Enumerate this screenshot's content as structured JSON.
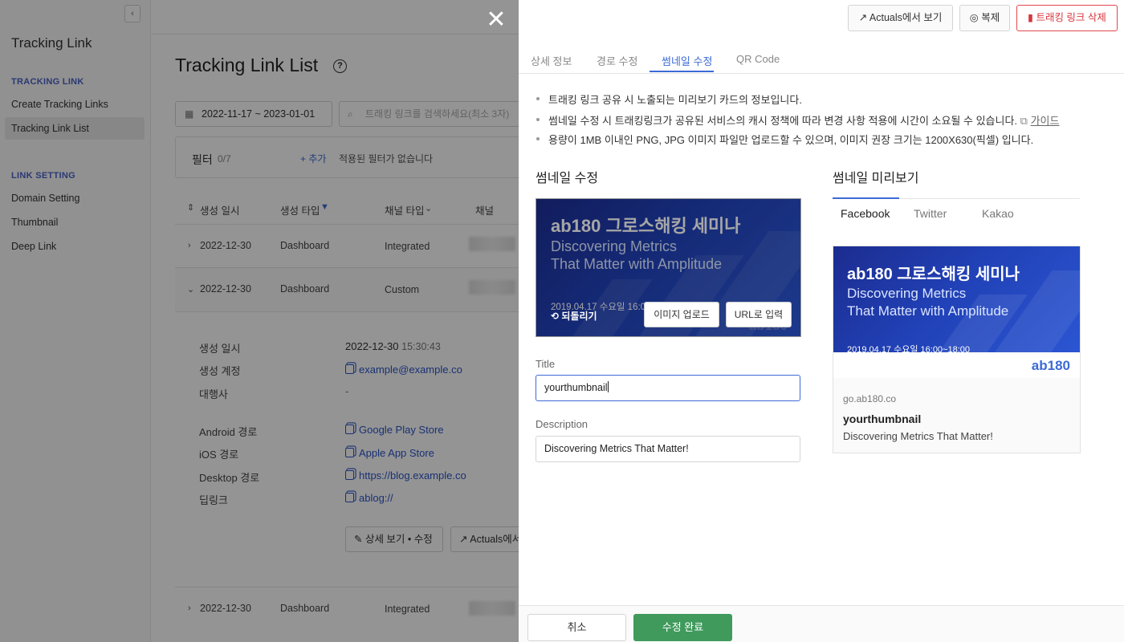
{
  "sidebar": {
    "collapse_icon": "‹",
    "app_title": "Tracking Link",
    "section1": "TRACKING LINK",
    "items1": [
      "Create Tracking Links",
      "Tracking Link List"
    ],
    "section2": "LINK SETTING",
    "items2": [
      "Domain Setting",
      "Thumbnail",
      "Deep Link"
    ]
  },
  "main": {
    "title": "Tracking Link List",
    "help_icon": "?",
    "date_range": "2022-11-17 ~ 2023-01-01",
    "search_placeholder": "트래킹 링크를 검색하세요(최소 3자)",
    "filter": {
      "label": "필터",
      "count": "0/7",
      "add": "+ 추가",
      "empty": "적용된 필터가 없습니다"
    },
    "columns": [
      "생성 일시",
      "생성 타입",
      "채널 타입",
      "채널"
    ],
    "rows": [
      {
        "date": "2022-12-30",
        "type": "Dashboard",
        "channel_type": "Integrated"
      },
      {
        "date": "2022-12-30",
        "type": "Dashboard",
        "channel_type": "Custom"
      },
      {
        "date": "2022-12-30",
        "type": "Dashboard",
        "channel_type": "Integrated"
      }
    ],
    "detail": {
      "created_at_label": "생성 일시",
      "created_at_date": "2022-12-30",
      "created_at_time": "15:30:43",
      "account_label": "생성 계정",
      "account": "example@example.co",
      "agency_label": "대행사",
      "agency": "-",
      "android_label": "Android 경로",
      "android": "Google Play Store",
      "ios_label": "iOS 경로",
      "ios": "Apple App Store",
      "desktop_label": "Desktop 경로",
      "desktop": "https://blog.example.co",
      "deeplink_label": "딥링크",
      "deeplink": "ablog://",
      "view_edit_btn": "상세 보기 • 수정",
      "actuals_btn": "Actuals에서 보기"
    }
  },
  "overlay": {
    "close_icon": "✕"
  },
  "drawer": {
    "actuals_btn": "Actuals에서 보기",
    "duplicate_btn": "복제",
    "delete_btn": "트래킹 링크 삭제",
    "tabs": [
      "상세 정보",
      "경로 수정",
      "썸네일 수정",
      "QR Code"
    ],
    "active_tab": "썸네일 수정",
    "notes": [
      "트래킹 링크 공유 시 노출되는 미리보기 카드의 정보입니다.",
      "썸네일 수정 시 트래킹링크가 공유된 서비스의 캐시 정책에 따라 변경 사항 적용에 시간이 소요될 수 있습니다.",
      "용량이 1MB 이내인 PNG, JPG 이미지 파일만 업로드할 수 있으며, 이미지 권장 크기는 1200X630(픽셀) 입니다."
    ],
    "guide_link": "가이드",
    "edit_section_title": "썸네일 수정",
    "thumbnail": {
      "headline": "ab180 그로스해킹 세미나",
      "sub1": "Discovering Metrics",
      "sub2": "That Matter with Amplitude",
      "date": "2019.04.17 수요일  16:00~18:00",
      "logo": "ab180"
    },
    "revert_btn": "⟲ 되돌리기",
    "upload_btn": "이미지 업로드",
    "url_btn": "URL로 입력",
    "title_label": "Title",
    "title_value": "yourthumbnail",
    "description_label": "Description",
    "description_value": "Discovering Metrics That Matter!",
    "preview_section_title": "썸네일 미리보기",
    "preview_tabs": [
      "Facebook",
      "Twitter",
      "Kakao"
    ],
    "preview": {
      "domain": "go.ab180.co",
      "title": "yourthumbnail",
      "description": "Discovering Metrics That Matter!"
    },
    "cancel_btn": "취소",
    "save_btn": "수정 완료"
  },
  "colors": {
    "accent": "#3c6ad7",
    "danger": "#d9363e",
    "save": "#3f9a5c"
  }
}
